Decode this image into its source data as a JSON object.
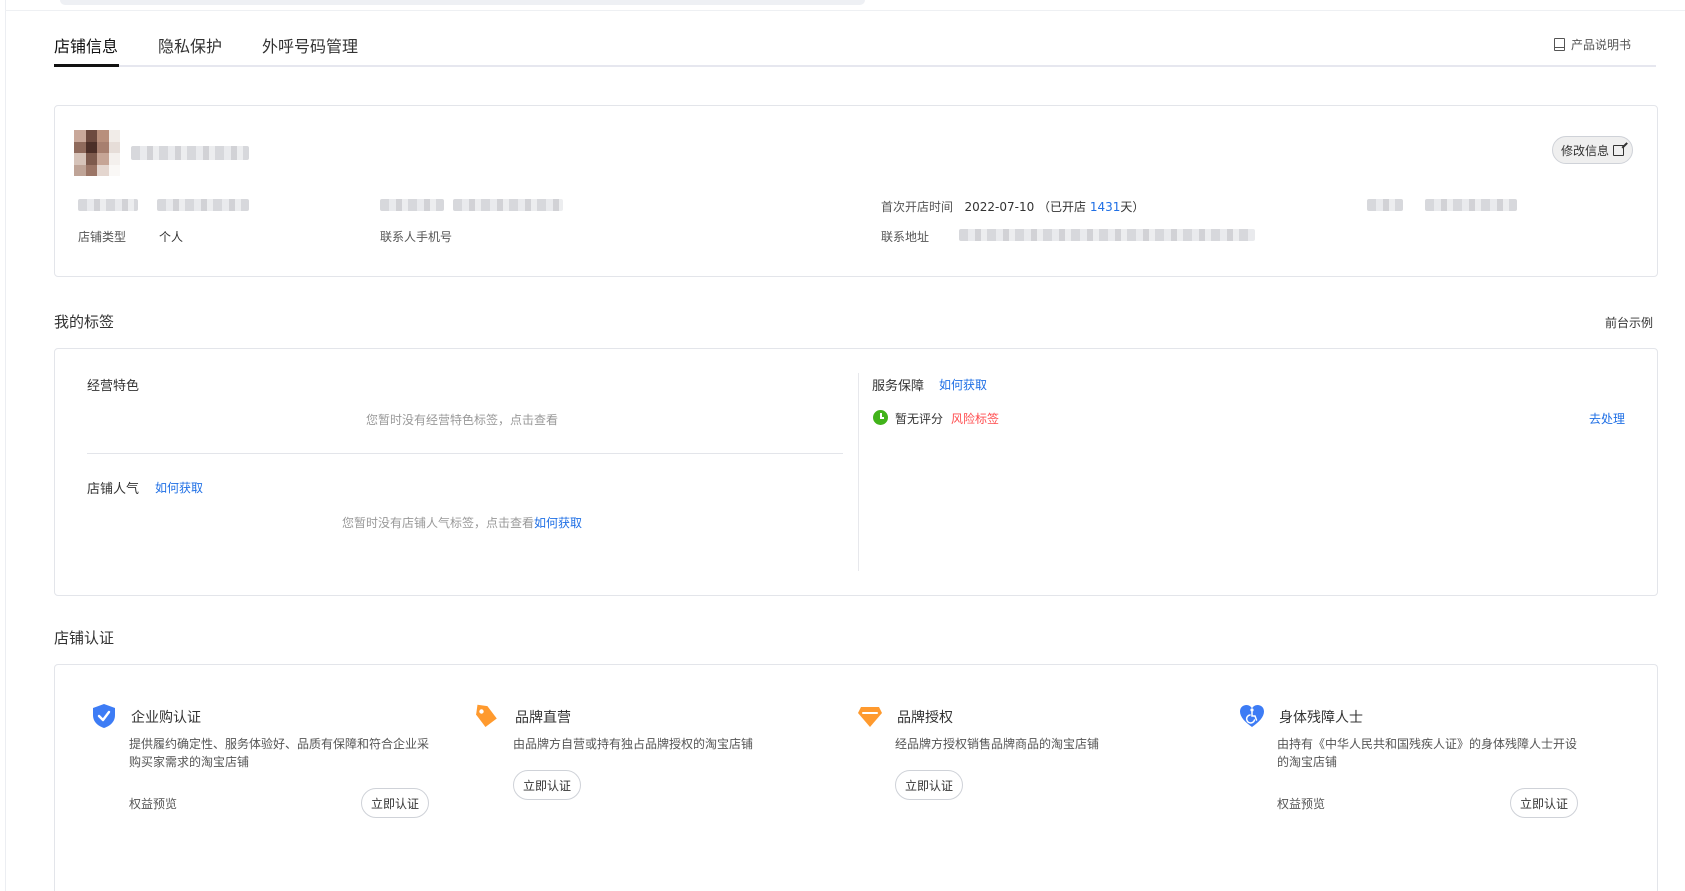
{
  "tabs": [
    {
      "label": "店铺信息",
      "active": true
    },
    {
      "label": "隐私保护",
      "active": false
    },
    {
      "label": "外呼号码管理",
      "active": false
    }
  ],
  "manual_label": "产品说明书",
  "shop": {
    "edit_label": "修改信息",
    "first_open_label": "首次开店时间",
    "first_open_date": "2022-07-10",
    "open_prefix": "（已开店 ",
    "open_days": "1431",
    "open_suffix": "天）",
    "shop_type_label": "店铺类型",
    "shop_type_value": "个人",
    "contact_phone_label": "联系人手机号",
    "contact_address_label": "联系地址"
  },
  "tags": {
    "title": "我的标签",
    "example_link": "前台示例",
    "feature_title": "经营特色",
    "feature_empty": "您暂时没有经营特色标签，点击查看",
    "popularity_title": "店铺人气",
    "popularity_link": "如何获取",
    "popularity_empty": "您暂时没有店铺人气标签，点击查看",
    "popularity_empty_link": "如何获取",
    "service_title": "服务保障",
    "service_link": "如何获取",
    "service_status": "暂无评分",
    "risk_label": "风险标签",
    "handle_link": "去处理"
  },
  "certification": {
    "title": "店铺认证",
    "items": [
      {
        "icon": "shield-check-icon",
        "color": "#3d7cf5",
        "title": "企业购认证",
        "desc": "提供履约确定性、服务体验好、品质有保障和符合企业采购买家需求的淘宝店铺",
        "benefit": "权益预览",
        "button": "立即认证"
      },
      {
        "icon": "tag-icon",
        "color": "#ff9a2e",
        "title": "品牌直营",
        "desc": "由品牌方自营或持有独占品牌授权的淘宝店铺",
        "benefit": "",
        "button": "立即认证"
      },
      {
        "icon": "diamond-icon",
        "color": "#ff9a2e",
        "title": "品牌授权",
        "desc": "经品牌方授权销售品牌商品的淘宝店铺",
        "benefit": "",
        "button": "立即认证"
      },
      {
        "icon": "accessibility-heart-icon",
        "color": "#3d7cf5",
        "title": "身体残障人士",
        "desc": "由持有《中华人民共和国残疾人证》的身体残障人士开设的淘宝店铺",
        "benefit": "权益预览",
        "button": "立即认证"
      }
    ]
  }
}
